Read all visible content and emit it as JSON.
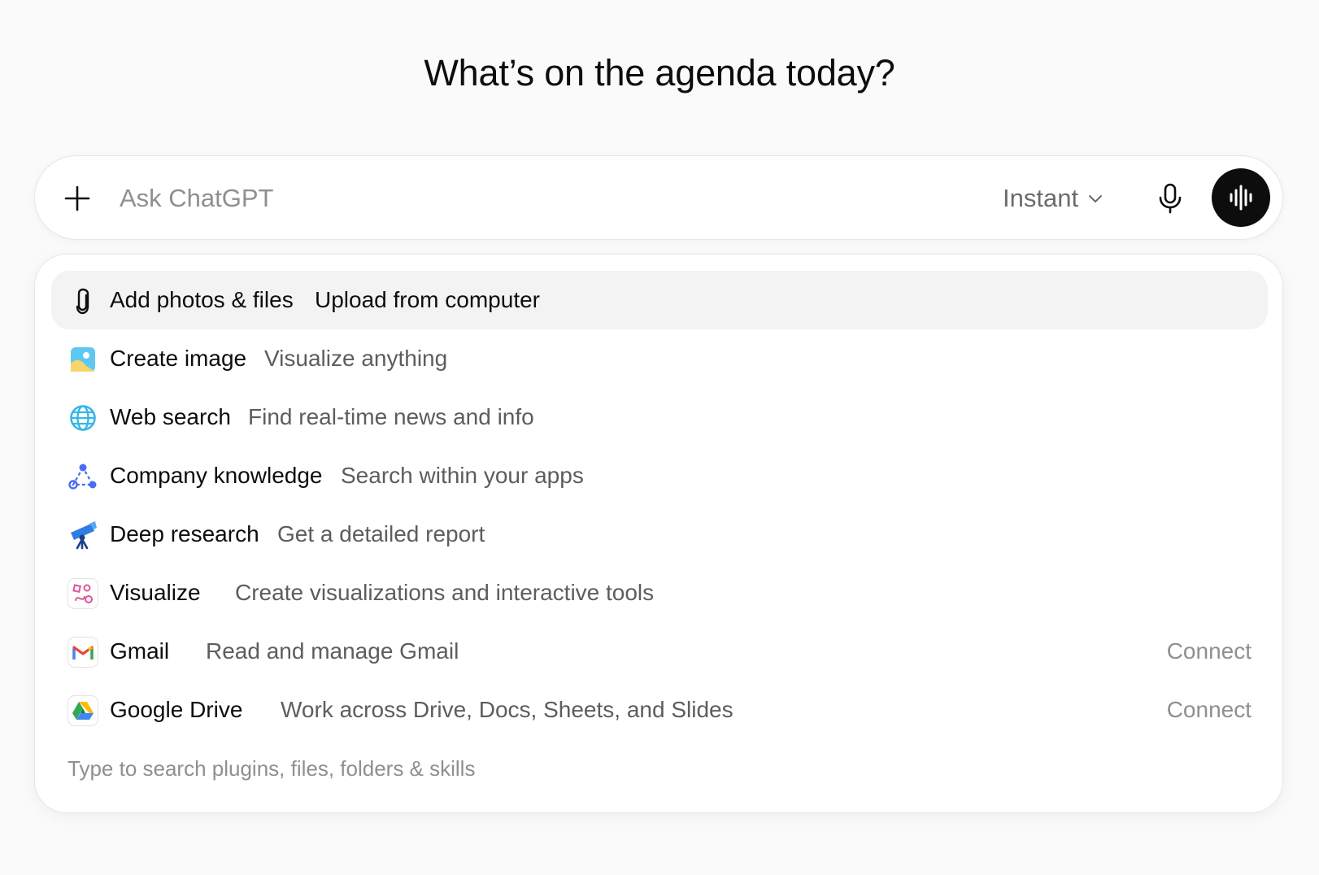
{
  "headline": "What’s on the agenda today?",
  "composer": {
    "placeholder": "Ask ChatGPT",
    "model_label": "Instant",
    "icons": {
      "add": "plus-icon",
      "model": "chevron-down-icon",
      "mic": "microphone-icon",
      "voice": "voice-waveform-icon"
    }
  },
  "menu": {
    "items": [
      {
        "label": "Add photos & files",
        "description": "Upload from computer",
        "icon": "paperclip-icon",
        "active": true
      },
      {
        "label": "Create image",
        "description": "Visualize anything",
        "icon": "image-icon"
      },
      {
        "label": "Web search",
        "description": "Find real-time news and info",
        "icon": "globe-icon"
      },
      {
        "label": "Company knowledge",
        "description": "Search within your apps",
        "icon": "network-icon"
      },
      {
        "label": "Deep research",
        "description": "Get a detailed report",
        "icon": "telescope-icon"
      },
      {
        "label": "Visualize",
        "description": "Create visualizations and interactive tools",
        "icon": "shapes-icon"
      },
      {
        "label": "Gmail",
        "description": "Read and manage Gmail",
        "icon": "gmail-icon",
        "action": "Connect"
      },
      {
        "label": "Google Drive",
        "description": "Work across Drive, Docs, Sheets, and Slides",
        "icon": "google-drive-icon",
        "action": "Connect"
      }
    ],
    "hint": "Type to search plugins, files, folders & skills"
  },
  "colors": {
    "background": "#fafafa",
    "active_row": "#f3f3f3",
    "voice_button": "#0d0d0d",
    "muted_text": "#8f8f8f"
  }
}
